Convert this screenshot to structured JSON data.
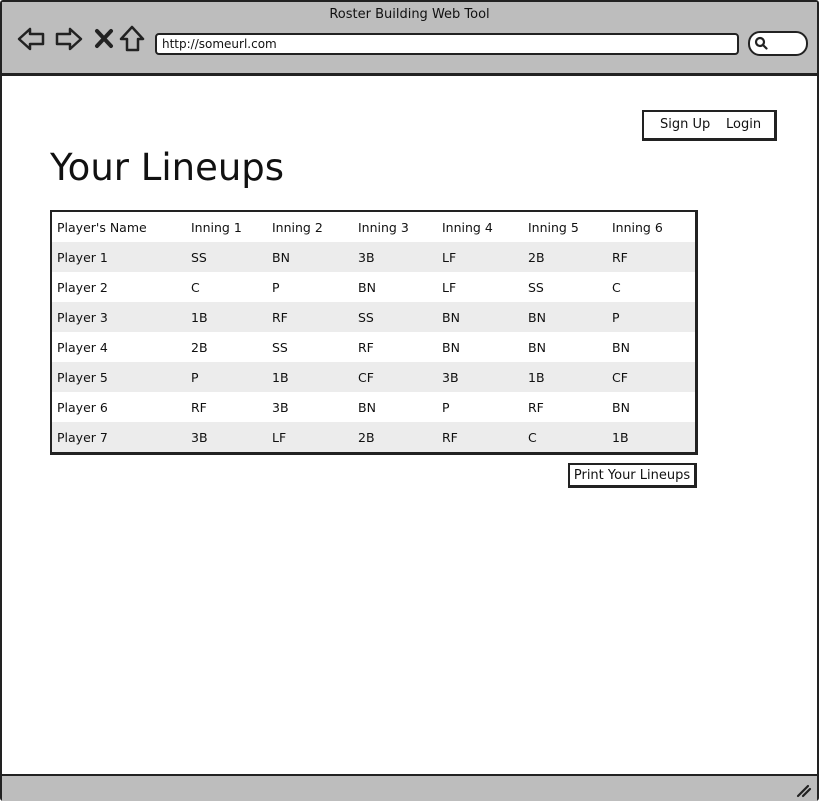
{
  "window": {
    "title": "Roster Building Web Tool"
  },
  "browser": {
    "url": "http://someurl.com",
    "search_icon": "search-icon"
  },
  "auth": {
    "sign_up": "Sign Up",
    "login": "Login"
  },
  "page": {
    "title": "Your Lineups"
  },
  "table": {
    "headers": [
      "Player's Name",
      "Inning 1",
      "Inning 2",
      "Inning 3",
      "Inning 4",
      "Inning 5",
      "Inning 6"
    ],
    "rows": [
      [
        "Player 1",
        "SS",
        "BN",
        "3B",
        "LF",
        "2B",
        "RF"
      ],
      [
        "Player 2",
        "C",
        "P",
        "BN",
        "LF",
        "SS",
        "C"
      ],
      [
        "Player 3",
        "1B",
        "RF",
        "SS",
        "BN",
        "BN",
        "P"
      ],
      [
        "Player 4",
        "2B",
        "SS",
        "RF",
        "BN",
        "BN",
        "BN"
      ],
      [
        "Player 5",
        "P",
        "1B",
        "CF",
        "3B",
        "1B",
        "CF"
      ],
      [
        "Player 6",
        "RF",
        "3B",
        "BN",
        "P",
        "RF",
        "BN"
      ],
      [
        "Player 7",
        "3B",
        "LF",
        "2B",
        "RF",
        "C",
        "1B"
      ]
    ]
  },
  "actions": {
    "print": "Print Your Lineups"
  }
}
